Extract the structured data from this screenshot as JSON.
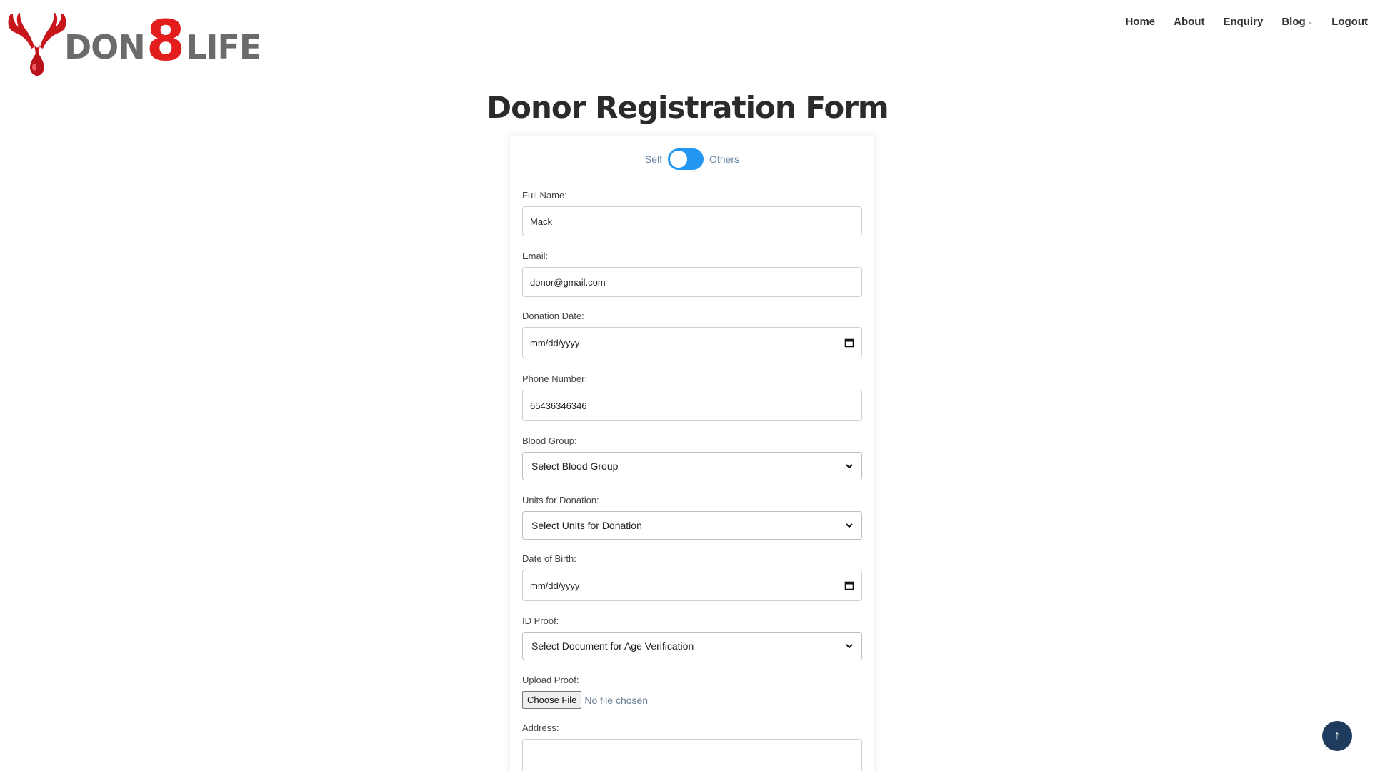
{
  "logo": {
    "text_prefix": "DON",
    "text_number": "8",
    "text_suffix": "LIFE"
  },
  "nav": {
    "items": [
      "Home",
      "About",
      "Enquiry",
      "Blog",
      "Logout"
    ]
  },
  "page_title": "Donor Registration Form",
  "toggle": {
    "left_label": "Self",
    "right_label": "Others"
  },
  "form": {
    "full_name": {
      "label": "Full Name:",
      "value": "Mack"
    },
    "email": {
      "label": "Email:",
      "value": "donor@gmail.com"
    },
    "donation_date": {
      "label": "Donation Date:",
      "value": "mm/dd/yyyy"
    },
    "phone": {
      "label": "Phone Number:",
      "value": "65436346346"
    },
    "blood_group": {
      "label": "Blood Group:",
      "selected": "Select Blood Group"
    },
    "units": {
      "label": "Units for Donation:",
      "selected": "Select Units for Donation"
    },
    "dob": {
      "label": "Date of Birth:",
      "value": "mm/dd/yyyy"
    },
    "id_proof": {
      "label": "ID Proof:",
      "selected": "Select Document for Age Verification"
    },
    "upload": {
      "label": "Upload Proof:",
      "button": "Choose File",
      "status": "No file chosen"
    },
    "address": {
      "label": "Address:",
      "value": ""
    }
  },
  "scroll_top": {
    "icon": "arrow-up-icon",
    "glyph": "↑"
  },
  "colors": {
    "brand_red": "#e31c1c",
    "logo_gray": "#6b6b6b",
    "toggle_blue": "#2196f3",
    "scroll_btn": "#1f3c5e"
  }
}
